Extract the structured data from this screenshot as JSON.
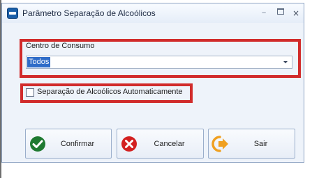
{
  "window": {
    "title": "Parâmetro Separação de Alcoólicos",
    "icon": "app-icon"
  },
  "titlebar_buttons": {
    "minimize": "minimize-icon",
    "maximize": "maximize-icon",
    "close": "×"
  },
  "consumo": {
    "label": "Centro de Consumo",
    "selected": "Todos"
  },
  "auto_separation": {
    "label": "Separação de Alcoólicos Automaticamente",
    "checked": false
  },
  "buttons": {
    "confirm": "Confirmar",
    "cancel": "Cancelar",
    "exit": "Sair"
  },
  "colors": {
    "highlight": "#d12b2b",
    "confirm_icon": "#1f7a31",
    "cancel_icon": "#d32020",
    "exit_icon": "#f0a020",
    "selection": "#2f6cc8"
  }
}
